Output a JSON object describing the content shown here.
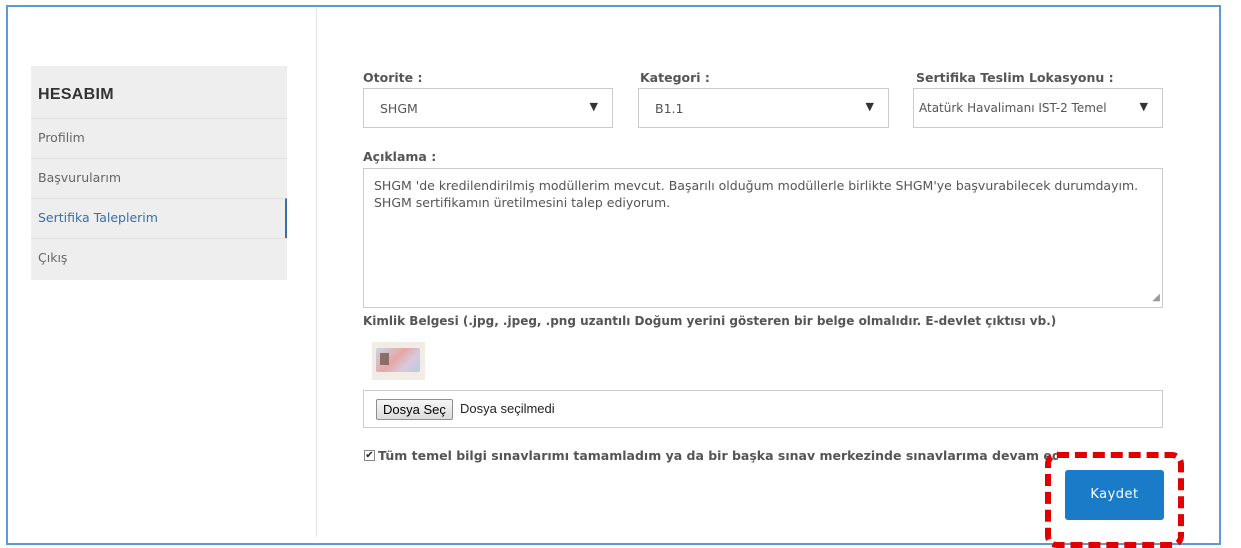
{
  "sidebar": {
    "title": "HESABIM",
    "items": [
      {
        "label": "Profilim"
      },
      {
        "label": "Başvurularım"
      },
      {
        "label": "Sertifika Taleplerim"
      },
      {
        "label": "Çıkış"
      }
    ]
  },
  "form": {
    "authority": {
      "label": "Otorite :",
      "value": "SHGM"
    },
    "category": {
      "label": "Kategori :",
      "value": "B1.1"
    },
    "location": {
      "label": "Sertifika Teslim Lokasyonu :",
      "value": "Atatürk Havalimanı IST-2 Temel"
    },
    "description": {
      "label": "Açıklama :",
      "lines": [
        "SHGM 'de kredilendirilmiş modüllerim mevcut. Başarılı olduğum modüllerle birlikte SHGM'ye başvurabilecek durumdayım.",
        "SHGM sertifikamın üretilmesini talep ediyorum."
      ]
    },
    "id_document": {
      "label": "Kimlik Belgesi (.jpg, .jpeg, .png uzantılı Doğum yerini gösteren bir belge olmalıdır. E-devlet çıktısı vb.)",
      "choose_button": "Dosya Seç",
      "status": "Dosya seçilmedi"
    },
    "confirm": {
      "checked": true,
      "label": "Tüm temel bilgi sınavlarımı tamamladım ya da bir başka sınav merkezinde sınavlarıma devam edeceğim."
    },
    "save_button": "Kaydet"
  },
  "colors": {
    "accent": "#1a7cc9",
    "highlight": "#e00000",
    "frame": "#5b9bd5"
  }
}
